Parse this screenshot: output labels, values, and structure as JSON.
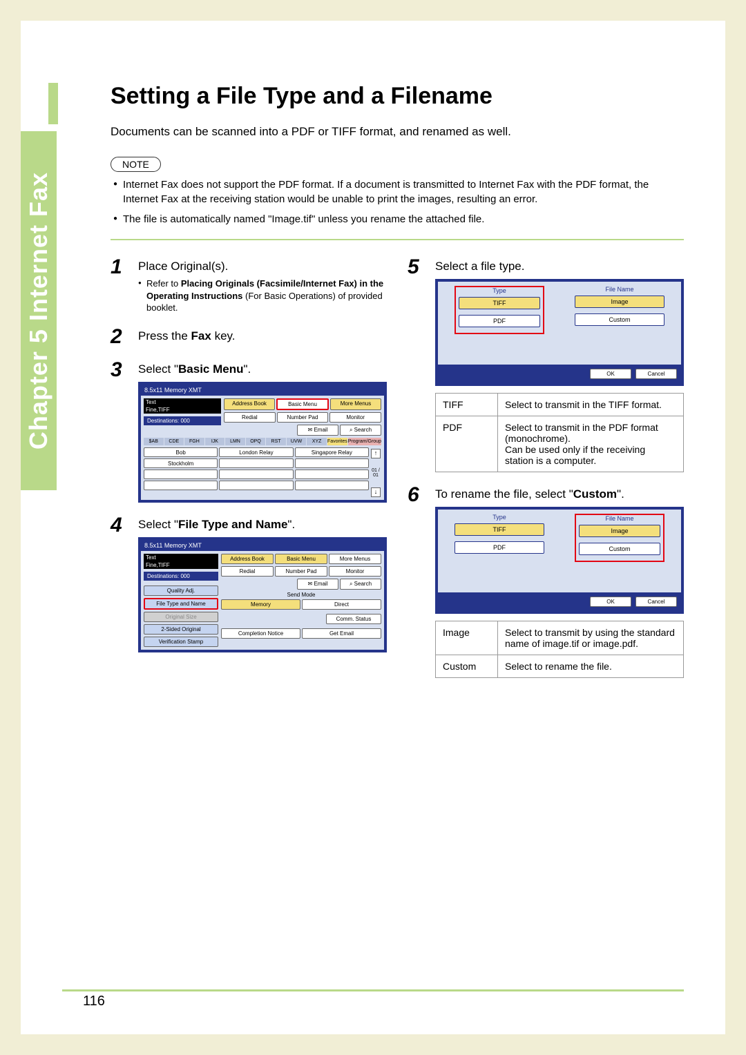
{
  "side_tab": "Chapter 5   Internet Fax",
  "title": "Setting a File Type and a Filename",
  "intro": "Documents can be scanned into a PDF or TIFF format, and renamed as well.",
  "note_label": "NOTE",
  "notes": [
    "Internet Fax does not support the PDF format. If a document is transmitted to Internet Fax with the PDF format, the Internet Fax at the receiving station would be unable to print the images, resulting an error.",
    "The file is automatically named \"Image.tif\" unless you rename the attached file."
  ],
  "steps": {
    "s1": {
      "num": "1",
      "text": "Place Original(s).",
      "sub_pre": "Refer to ",
      "sub_bold": "Placing Originals (Facsimile/Internet Fax) in the Operating Instructions",
      "sub_post": " (For Basic Operations) of provided booklet."
    },
    "s2": {
      "num": "2",
      "text_pre": "Press the ",
      "text_bold": "Fax",
      "text_post": " key."
    },
    "s3": {
      "num": "3",
      "text_pre": "Select \"",
      "text_bold": "Basic Menu",
      "text_post": "\"."
    },
    "s4": {
      "num": "4",
      "text_pre": "Select \"",
      "text_bold": "File Type and Name",
      "text_post": "\"."
    },
    "s5": {
      "num": "5",
      "text": "Select a file type."
    },
    "s6": {
      "num": "6",
      "text_pre": "To rename the file, select \"",
      "text_bold": "Custom",
      "text_post": "\"."
    }
  },
  "screen1": {
    "title_left": "8.5x11   Memory XMT",
    "mode_lines": [
      "Text",
      "Fine,TIFF"
    ],
    "top_buttons": [
      "Address Book",
      "Basic Menu",
      "More Menus"
    ],
    "mid_buttons": [
      "Redial",
      "Number Pad",
      "Monitor"
    ],
    "dest": "Destinations: 000",
    "util_buttons": [
      "Email",
      "Search"
    ],
    "alpha": [
      "$AB",
      "CDE",
      "FGH",
      "IJK",
      "LMN",
      "OPQ",
      "RST",
      "UVW",
      "XYZ",
      "Favorites",
      "Program/Group"
    ],
    "contacts_row1": [
      "Bob",
      "London Relay",
      "Singapore Relay"
    ],
    "contacts_row2": [
      "Stockholm",
      "",
      ""
    ],
    "scroll_label": "01 / 01"
  },
  "screen2": {
    "title_left": "8.5x11   Memory XMT",
    "mode_lines": [
      "Text",
      "Fine,TIFF"
    ],
    "top_buttons": [
      "Address Book",
      "Basic Menu",
      "More Menus"
    ],
    "mid_buttons": [
      "Redial",
      "Number Pad",
      "Monitor"
    ],
    "dest": "Destinations: 000",
    "util_buttons": [
      "Email",
      "Search"
    ],
    "send_mode": "Send Mode",
    "left_buttons": [
      "Quality Adj.",
      "File Type and Name",
      "Original Size",
      "2-Sided Original",
      "Verification Stamp"
    ],
    "right_buttons_top": [
      "Memory",
      "Direct"
    ],
    "right_buttons_row2": [
      "Comm. Status"
    ],
    "right_buttons_row3": [
      "Completion Notice",
      "Get Email"
    ]
  },
  "screen3": {
    "type_label": "Type",
    "filename_label": "File Name",
    "type_opts": [
      "TIFF",
      "PDF"
    ],
    "name_opts": [
      "Image",
      "Custom"
    ],
    "ok": "OK",
    "cancel": "Cancel"
  },
  "table1": {
    "r1c1": "TIFF",
    "r1c2": "Select to transmit in the TIFF format.",
    "r2c1": "PDF",
    "r2c2": "Select to transmit in the PDF format (monochrome).\nCan be used only if the receiving station is a computer."
  },
  "table2": {
    "r1c1": "Image",
    "r1c2": "Select to transmit by using the standard name of image.tif or image.pdf.",
    "r2c1": "Custom",
    "r2c2": "Select to rename the file."
  },
  "page_number": "116"
}
